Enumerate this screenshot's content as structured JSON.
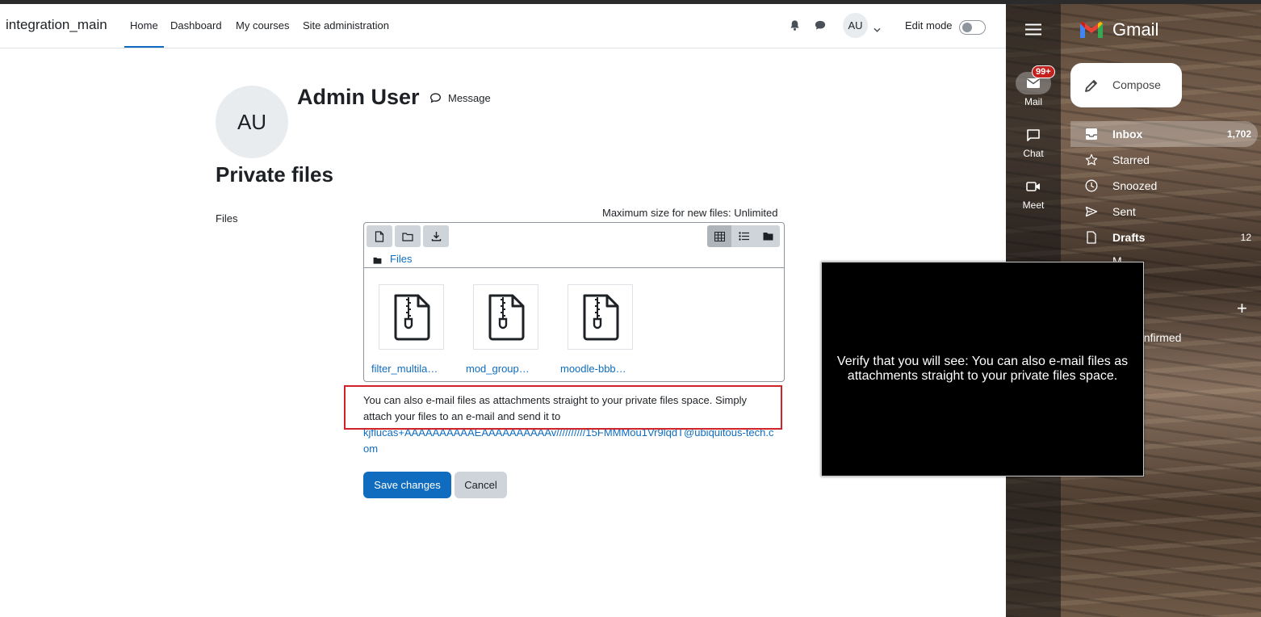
{
  "moodle": {
    "brand": "integration_main",
    "nav": {
      "home": "Home",
      "dashboard": "Dashboard",
      "my_courses": "My courses",
      "site_admin": "Site administration"
    },
    "user_initials": "AU",
    "edit_mode_label": "Edit mode",
    "edit_mode_on": false,
    "profile": {
      "initials": "AU",
      "name": "Admin User",
      "message_label": "Message"
    },
    "page_title": "Private files",
    "files_label": "Files",
    "max_size": "Maximum size for new files: Unlimited",
    "filemanager": {
      "path": "Files",
      "files": [
        {
          "name": "filter_multilang2.zip",
          "display": "filter_multila…"
        },
        {
          "name": "mod_groupselect.zip",
          "display": "mod_group…"
        },
        {
          "name": "moodle-bbb.zip",
          "display": "moodle-bbb…"
        }
      ],
      "active_view": "icons"
    },
    "help_text": "You can also e-mail files as attachments straight to your private files space. Simply attach your files to an e-mail and send it to",
    "help_email": "kjflucas+AAAAAAAAAAEAAAAAAAAAAv//////////15FMMMou1Vr9lqdT@ubiquitous-tech.com",
    "save_label": "Save changes",
    "cancel_label": "Cancel"
  },
  "gmail": {
    "logo_text": "Gmail",
    "rail": {
      "mail": "Mail",
      "mail_badge": "99+",
      "chat": "Chat",
      "meet": "Meet"
    },
    "compose_label": "Compose",
    "folders": {
      "inbox": "Inbox",
      "inbox_count": "1,702",
      "starred": "Starred",
      "snoozed": "Snoozed",
      "sent": "Sent",
      "drafts": "Drafts",
      "drafts_count": "12"
    },
    "partial_more": "M",
    "partial_label": "onfirmed"
  },
  "overlay": {
    "text": "Verify that you will see: You can also e-mail files as attachments straight to your private files space."
  },
  "colors": {
    "primary": "#0f6cbf",
    "highlight": "#d0222b",
    "badge": "#c5221f"
  }
}
